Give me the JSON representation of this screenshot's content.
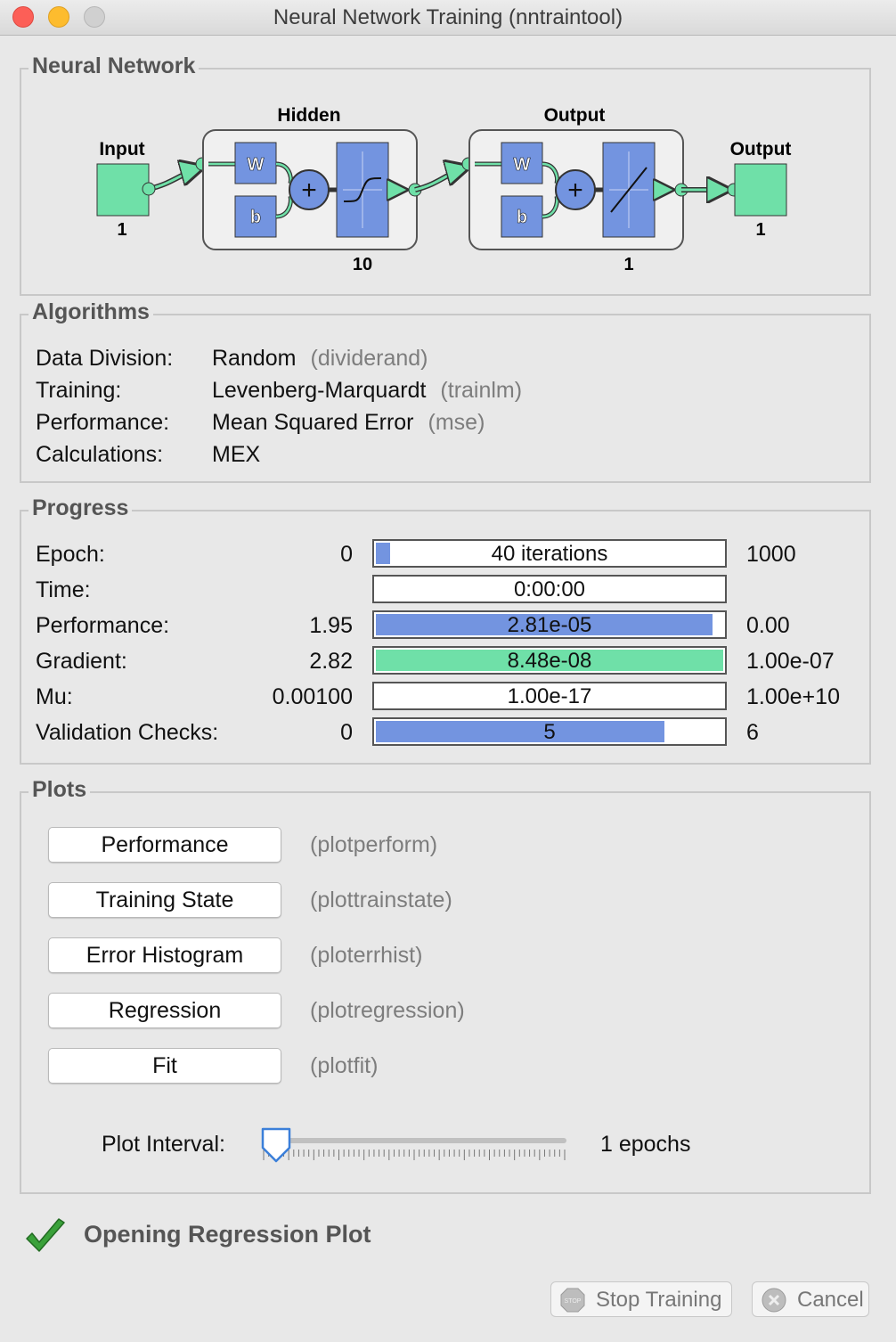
{
  "window": {
    "title": "Neural Network Training (nntraintool)"
  },
  "network": {
    "group_label": "Neural Network",
    "input_label": "Input",
    "input_size": "1",
    "hidden_label": "Hidden",
    "hidden_size": "10",
    "output_layer_label": "Output",
    "output_layer_size": "1",
    "output_label": "Output",
    "output_size": "1",
    "weight_symbol": "W",
    "bias_symbol": "b",
    "colors": {
      "node": "#6fe0a8",
      "block": "#7394e0"
    }
  },
  "algorithms": {
    "group_label": "Algorithms",
    "rows": [
      {
        "key": "Data Division:",
        "value": "Random",
        "fn": "(dividerand)"
      },
      {
        "key": "Training:",
        "value": "Levenberg-Marquardt",
        "fn": "(trainlm)"
      },
      {
        "key": "Performance:",
        "value": "Mean Squared Error",
        "fn": "(mse)"
      },
      {
        "key": "Calculations:",
        "value": "MEX",
        "fn": ""
      }
    ]
  },
  "progress": {
    "group_label": "Progress",
    "rows": [
      {
        "label": "Epoch:",
        "start": "0",
        "current": "40 iterations",
        "end": "1000",
        "fill_fraction": 0.04,
        "color": "#7394e0"
      },
      {
        "label": "Time:",
        "start": "",
        "current": "0:00:00",
        "end": "",
        "fill_fraction": 0,
        "color": "#7394e0"
      },
      {
        "label": "Performance:",
        "start": "1.95",
        "current": "2.81e-05",
        "end": "0.00",
        "fill_fraction": 0.97,
        "color": "#7394e0"
      },
      {
        "label": "Gradient:",
        "start": "2.82",
        "current": "8.48e-08",
        "end": "1.00e-07",
        "fill_fraction": 1.0,
        "color": "#6fe0a8"
      },
      {
        "label": "Mu:",
        "start": "0.00100",
        "current": "1.00e-17",
        "end": "1.00e+10",
        "fill_fraction": 0,
        "color": "#7394e0"
      },
      {
        "label": "Validation Checks:",
        "start": "0",
        "current": "5",
        "end": "6",
        "fill_fraction": 0.83,
        "color": "#7394e0"
      }
    ]
  },
  "plots": {
    "group_label": "Plots",
    "buttons": [
      {
        "label": "Performance",
        "fn": "(plotperform)"
      },
      {
        "label": "Training State",
        "fn": "(plottrainstate)"
      },
      {
        "label": "Error Histogram",
        "fn": "(ploterrhist)"
      },
      {
        "label": "Regression",
        "fn": "(plotregression)"
      },
      {
        "label": "Fit",
        "fn": "(plotfit)"
      }
    ],
    "interval_label": "Plot Interval:",
    "interval_value": "1 epochs",
    "interval_fraction": 0
  },
  "status": {
    "text": "Opening Regression Plot",
    "icon": "checkmark-icon"
  },
  "footer": {
    "stop_label": "Stop Training",
    "cancel_label": "Cancel"
  }
}
